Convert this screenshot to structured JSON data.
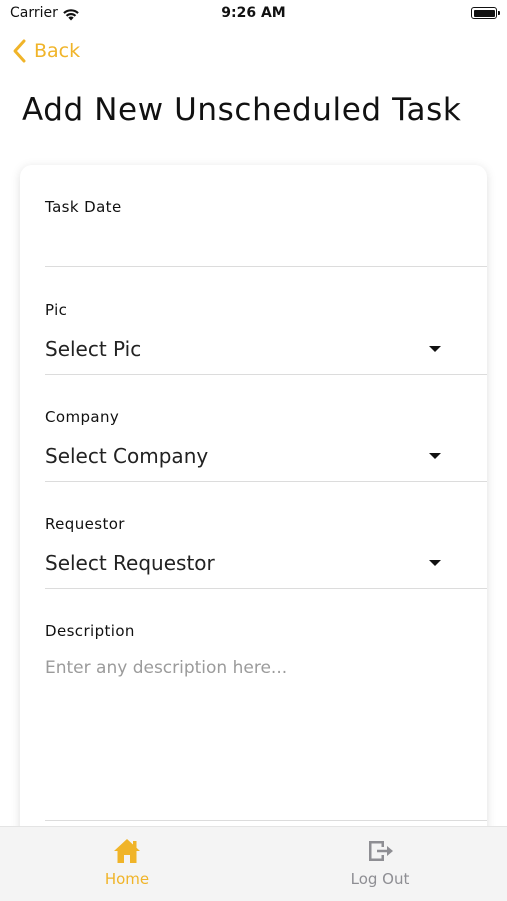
{
  "status_bar": {
    "carrier": "Carrier",
    "time": "9:26 AM"
  },
  "nav": {
    "back_label": "Back",
    "accent_color": "#f0b429"
  },
  "page": {
    "title": "Add New Unscheduled Task"
  },
  "form": {
    "task_date": {
      "label": "Task Date",
      "value": ""
    },
    "pic": {
      "label": "Pic",
      "value": "Select Pic"
    },
    "company": {
      "label": "Company",
      "value": "Select Company"
    },
    "requestor": {
      "label": "Requestor",
      "value": "Select Requestor"
    },
    "description": {
      "label": "Description",
      "placeholder": "Enter any description here..."
    }
  },
  "tab_bar": {
    "items": [
      {
        "label": "Home",
        "icon": "home-icon",
        "active": true,
        "color": "#f0b429"
      },
      {
        "label": "Log Out",
        "icon": "logout-icon",
        "active": false,
        "color": "#8e8e93"
      }
    ]
  }
}
